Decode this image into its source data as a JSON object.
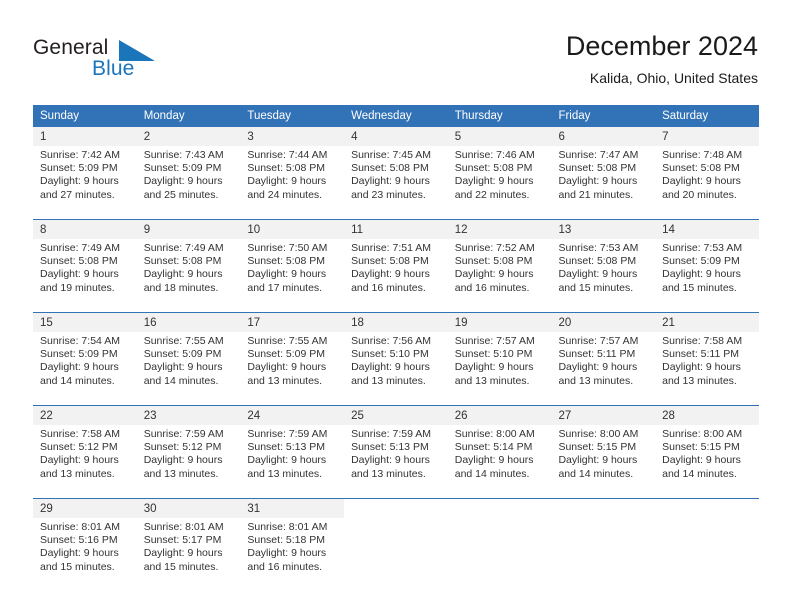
{
  "brand": {
    "name_top": "General",
    "name_bottom": "Blue",
    "triangle_color": "#1b75bb",
    "top_color": "#231f20"
  },
  "header": {
    "title": "December 2024",
    "subtitle": "Kalida, Ohio, United States"
  },
  "theme": {
    "header_blue": "#3272b6",
    "daynum_band": "#f2f2f2",
    "text": "#333333"
  },
  "calendar": {
    "weekday_headers": [
      "Sunday",
      "Monday",
      "Tuesday",
      "Wednesday",
      "Thursday",
      "Friday",
      "Saturday"
    ],
    "weeks": [
      [
        {
          "day": "1",
          "sunrise": "Sunrise: 7:42 AM",
          "sunset": "Sunset: 5:09 PM",
          "daylight1": "Daylight: 9 hours",
          "daylight2": "and 27 minutes."
        },
        {
          "day": "2",
          "sunrise": "Sunrise: 7:43 AM",
          "sunset": "Sunset: 5:09 PM",
          "daylight1": "Daylight: 9 hours",
          "daylight2": "and 25 minutes."
        },
        {
          "day": "3",
          "sunrise": "Sunrise: 7:44 AM",
          "sunset": "Sunset: 5:08 PM",
          "daylight1": "Daylight: 9 hours",
          "daylight2": "and 24 minutes."
        },
        {
          "day": "4",
          "sunrise": "Sunrise: 7:45 AM",
          "sunset": "Sunset: 5:08 PM",
          "daylight1": "Daylight: 9 hours",
          "daylight2": "and 23 minutes."
        },
        {
          "day": "5",
          "sunrise": "Sunrise: 7:46 AM",
          "sunset": "Sunset: 5:08 PM",
          "daylight1": "Daylight: 9 hours",
          "daylight2": "and 22 minutes."
        },
        {
          "day": "6",
          "sunrise": "Sunrise: 7:47 AM",
          "sunset": "Sunset: 5:08 PM",
          "daylight1": "Daylight: 9 hours",
          "daylight2": "and 21 minutes."
        },
        {
          "day": "7",
          "sunrise": "Sunrise: 7:48 AM",
          "sunset": "Sunset: 5:08 PM",
          "daylight1": "Daylight: 9 hours",
          "daylight2": "and 20 minutes."
        }
      ],
      [
        {
          "day": "8",
          "sunrise": "Sunrise: 7:49 AM",
          "sunset": "Sunset: 5:08 PM",
          "daylight1": "Daylight: 9 hours",
          "daylight2": "and 19 minutes."
        },
        {
          "day": "9",
          "sunrise": "Sunrise: 7:49 AM",
          "sunset": "Sunset: 5:08 PM",
          "daylight1": "Daylight: 9 hours",
          "daylight2": "and 18 minutes."
        },
        {
          "day": "10",
          "sunrise": "Sunrise: 7:50 AM",
          "sunset": "Sunset: 5:08 PM",
          "daylight1": "Daylight: 9 hours",
          "daylight2": "and 17 minutes."
        },
        {
          "day": "11",
          "sunrise": "Sunrise: 7:51 AM",
          "sunset": "Sunset: 5:08 PM",
          "daylight1": "Daylight: 9 hours",
          "daylight2": "and 16 minutes."
        },
        {
          "day": "12",
          "sunrise": "Sunrise: 7:52 AM",
          "sunset": "Sunset: 5:08 PM",
          "daylight1": "Daylight: 9 hours",
          "daylight2": "and 16 minutes."
        },
        {
          "day": "13",
          "sunrise": "Sunrise: 7:53 AM",
          "sunset": "Sunset: 5:08 PM",
          "daylight1": "Daylight: 9 hours",
          "daylight2": "and 15 minutes."
        },
        {
          "day": "14",
          "sunrise": "Sunrise: 7:53 AM",
          "sunset": "Sunset: 5:09 PM",
          "daylight1": "Daylight: 9 hours",
          "daylight2": "and 15 minutes."
        }
      ],
      [
        {
          "day": "15",
          "sunrise": "Sunrise: 7:54 AM",
          "sunset": "Sunset: 5:09 PM",
          "daylight1": "Daylight: 9 hours",
          "daylight2": "and 14 minutes."
        },
        {
          "day": "16",
          "sunrise": "Sunrise: 7:55 AM",
          "sunset": "Sunset: 5:09 PM",
          "daylight1": "Daylight: 9 hours",
          "daylight2": "and 14 minutes."
        },
        {
          "day": "17",
          "sunrise": "Sunrise: 7:55 AM",
          "sunset": "Sunset: 5:09 PM",
          "daylight1": "Daylight: 9 hours",
          "daylight2": "and 13 minutes."
        },
        {
          "day": "18",
          "sunrise": "Sunrise: 7:56 AM",
          "sunset": "Sunset: 5:10 PM",
          "daylight1": "Daylight: 9 hours",
          "daylight2": "and 13 minutes."
        },
        {
          "day": "19",
          "sunrise": "Sunrise: 7:57 AM",
          "sunset": "Sunset: 5:10 PM",
          "daylight1": "Daylight: 9 hours",
          "daylight2": "and 13 minutes."
        },
        {
          "day": "20",
          "sunrise": "Sunrise: 7:57 AM",
          "sunset": "Sunset: 5:11 PM",
          "daylight1": "Daylight: 9 hours",
          "daylight2": "and 13 minutes."
        },
        {
          "day": "21",
          "sunrise": "Sunrise: 7:58 AM",
          "sunset": "Sunset: 5:11 PM",
          "daylight1": "Daylight: 9 hours",
          "daylight2": "and 13 minutes."
        }
      ],
      [
        {
          "day": "22",
          "sunrise": "Sunrise: 7:58 AM",
          "sunset": "Sunset: 5:12 PM",
          "daylight1": "Daylight: 9 hours",
          "daylight2": "and 13 minutes."
        },
        {
          "day": "23",
          "sunrise": "Sunrise: 7:59 AM",
          "sunset": "Sunset: 5:12 PM",
          "daylight1": "Daylight: 9 hours",
          "daylight2": "and 13 minutes."
        },
        {
          "day": "24",
          "sunrise": "Sunrise: 7:59 AM",
          "sunset": "Sunset: 5:13 PM",
          "daylight1": "Daylight: 9 hours",
          "daylight2": "and 13 minutes."
        },
        {
          "day": "25",
          "sunrise": "Sunrise: 7:59 AM",
          "sunset": "Sunset: 5:13 PM",
          "daylight1": "Daylight: 9 hours",
          "daylight2": "and 13 minutes."
        },
        {
          "day": "26",
          "sunrise": "Sunrise: 8:00 AM",
          "sunset": "Sunset: 5:14 PM",
          "daylight1": "Daylight: 9 hours",
          "daylight2": "and 14 minutes."
        },
        {
          "day": "27",
          "sunrise": "Sunrise: 8:00 AM",
          "sunset": "Sunset: 5:15 PM",
          "daylight1": "Daylight: 9 hours",
          "daylight2": "and 14 minutes."
        },
        {
          "day": "28",
          "sunrise": "Sunrise: 8:00 AM",
          "sunset": "Sunset: 5:15 PM",
          "daylight1": "Daylight: 9 hours",
          "daylight2": "and 14 minutes."
        }
      ],
      [
        {
          "day": "29",
          "sunrise": "Sunrise: 8:01 AM",
          "sunset": "Sunset: 5:16 PM",
          "daylight1": "Daylight: 9 hours",
          "daylight2": "and 15 minutes."
        },
        {
          "day": "30",
          "sunrise": "Sunrise: 8:01 AM",
          "sunset": "Sunset: 5:17 PM",
          "daylight1": "Daylight: 9 hours",
          "daylight2": "and 15 minutes."
        },
        {
          "day": "31",
          "sunrise": "Sunrise: 8:01 AM",
          "sunset": "Sunset: 5:18 PM",
          "daylight1": "Daylight: 9 hours",
          "daylight2": "and 16 minutes."
        },
        {
          "day": "",
          "sunrise": "",
          "sunset": "",
          "daylight1": "",
          "daylight2": ""
        },
        {
          "day": "",
          "sunrise": "",
          "sunset": "",
          "daylight1": "",
          "daylight2": ""
        },
        {
          "day": "",
          "sunrise": "",
          "sunset": "",
          "daylight1": "",
          "daylight2": ""
        },
        {
          "day": "",
          "sunrise": "",
          "sunset": "",
          "daylight1": "",
          "daylight2": ""
        }
      ]
    ]
  }
}
